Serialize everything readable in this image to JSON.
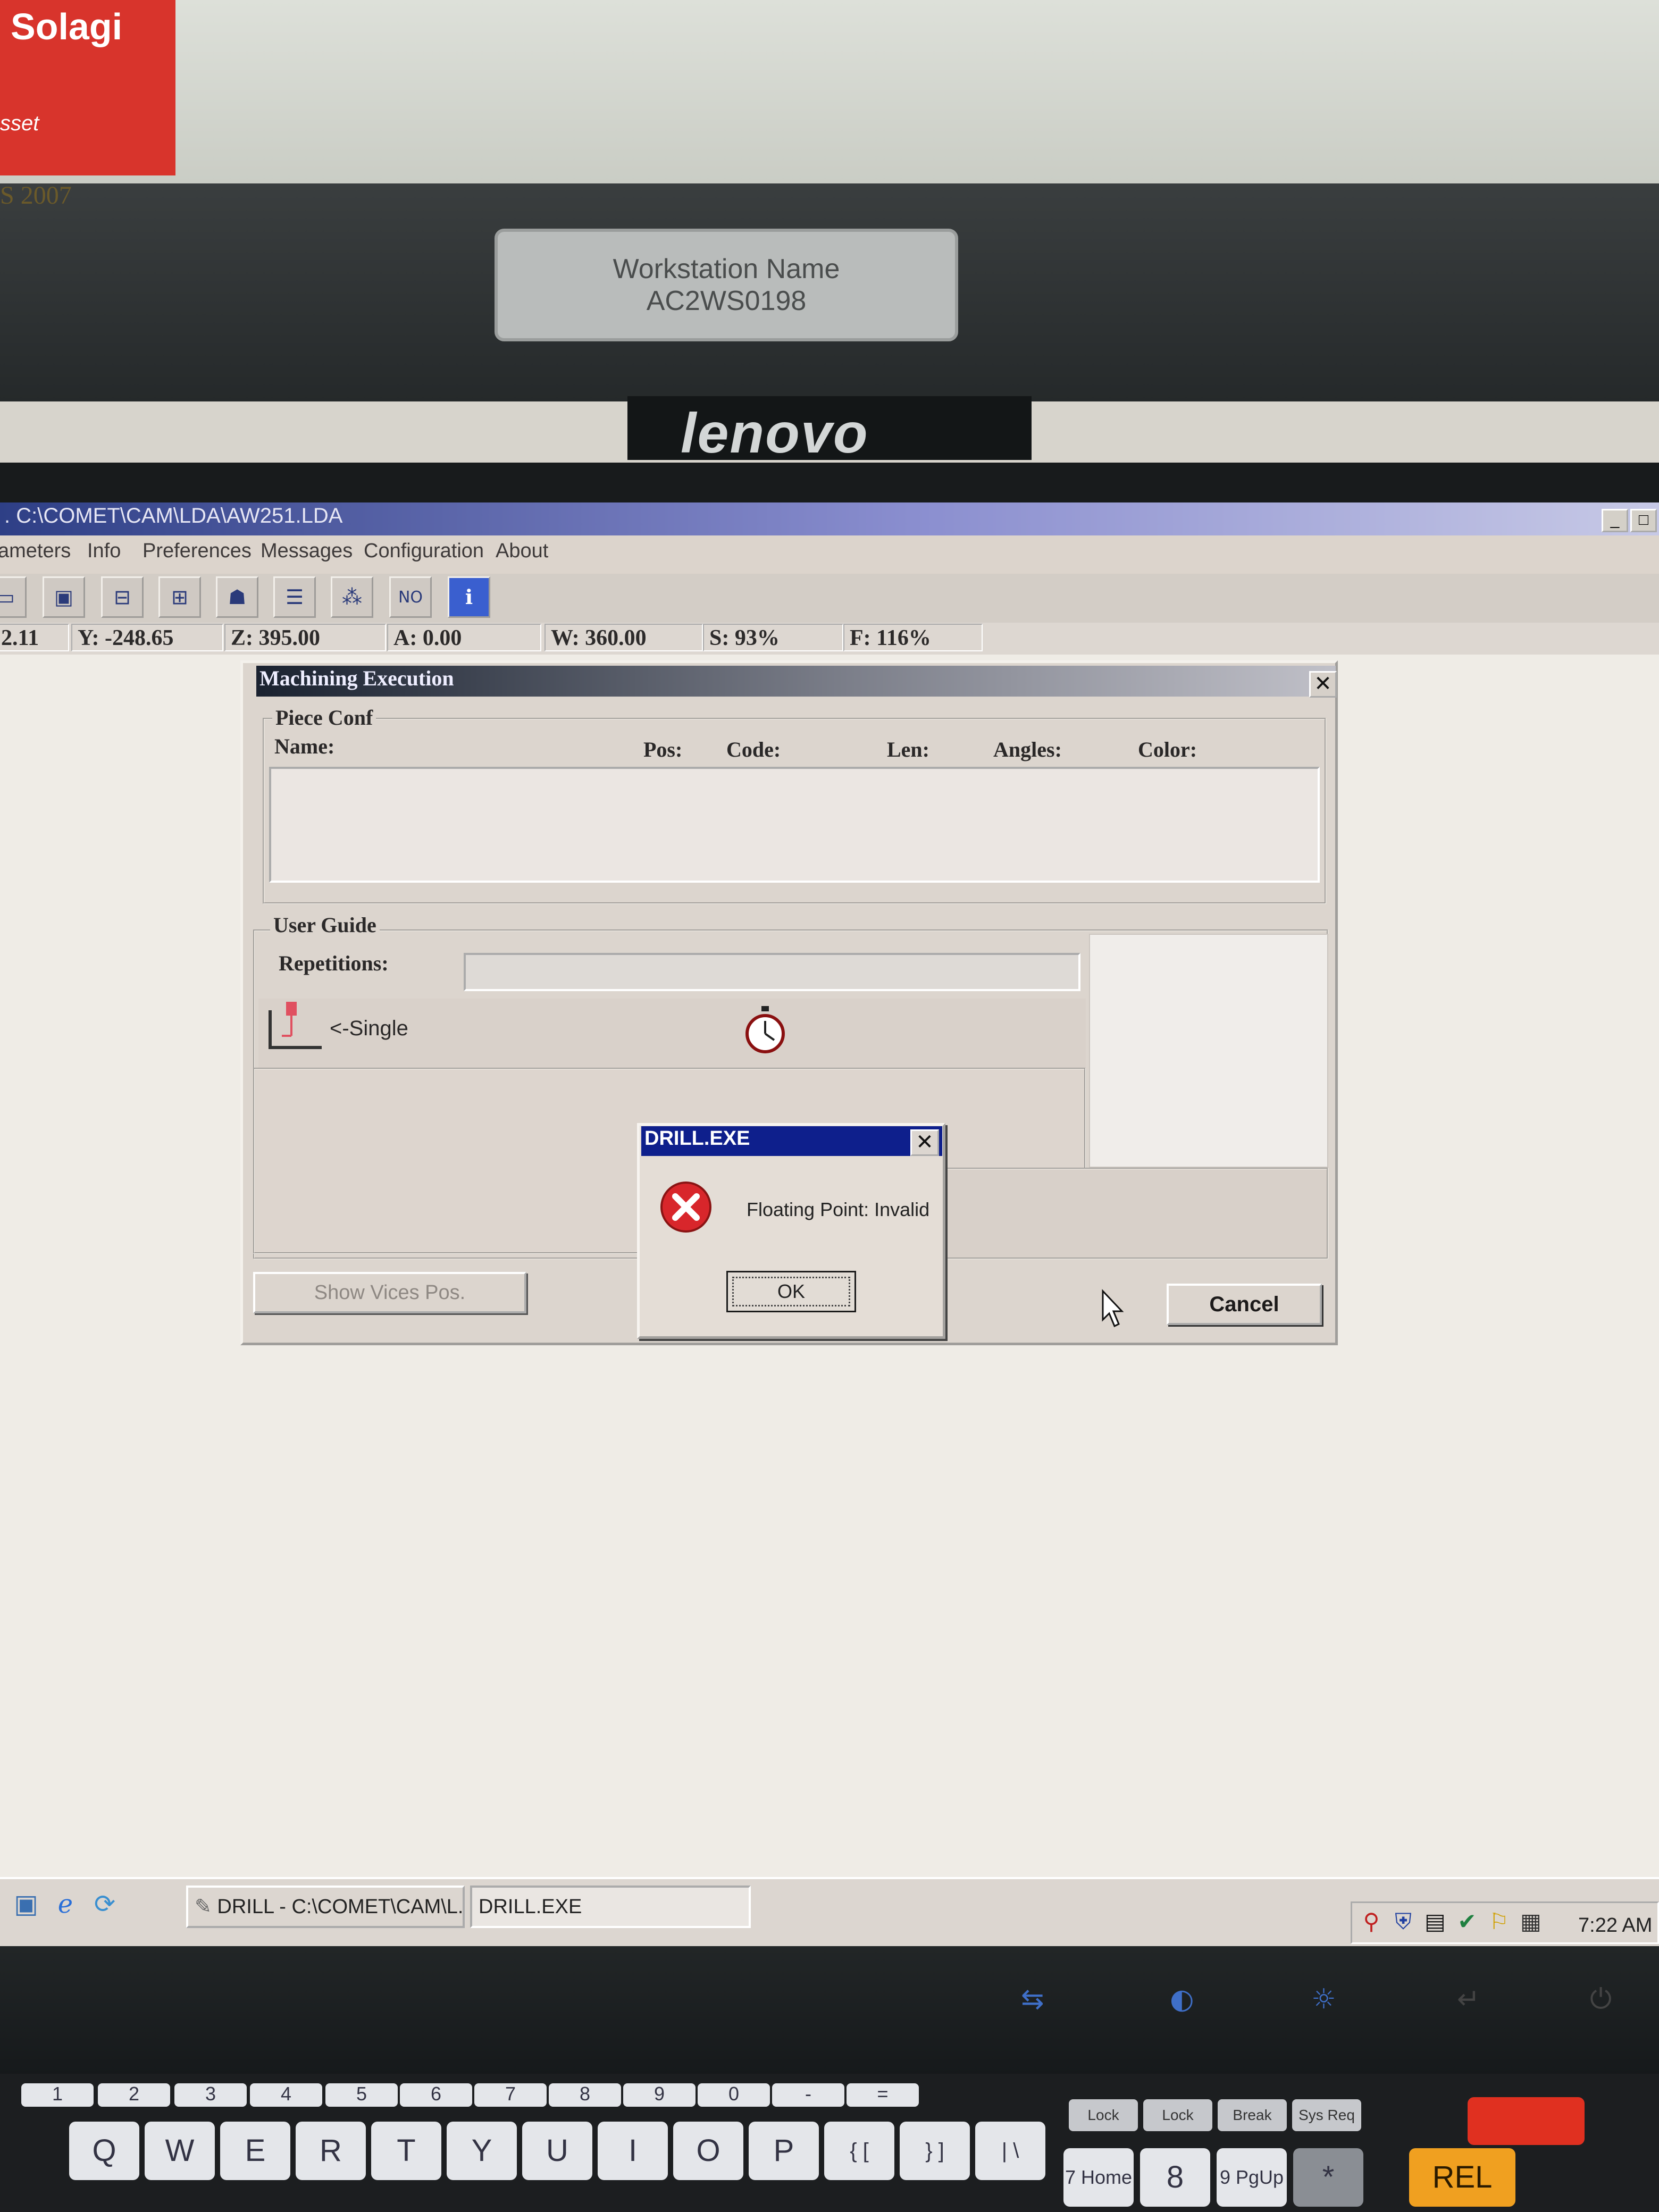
{
  "environment": {
    "sticker_text": "Solagi",
    "sticker_sub": "sset",
    "edge_text": "S 2007",
    "workstation_label": [
      "Workstation Name",
      "AC2WS0198"
    ],
    "brand": "lenovo"
  },
  "window": {
    "title": ". C:\\COMET\\CAM\\LDA\\AW251.LDA",
    "menus": [
      "ameters",
      "Info",
      "Preferences",
      "Messages",
      "Configuration",
      "About"
    ]
  },
  "toolbar": {
    "tools": [
      "tool-1",
      "tool-2",
      "tool-3",
      "tool-4",
      "tool-5",
      "tool-6",
      "tool-7",
      "NO",
      "tool-9"
    ],
    "status": {
      "x": "2.11",
      "y": "Y: -248.65",
      "z": "Z: 395.00",
      "a": "A: 0.00",
      "w": "W: 360.00",
      "s": "S: 93%",
      "f": "F: 116%"
    }
  },
  "machining_dialog": {
    "title": "Machining Execution",
    "piece_conf": {
      "label": "Piece Conf",
      "columns": [
        "Name:",
        "Pos:",
        "Code:",
        "Len:",
        "Angles:",
        "Color:"
      ],
      "rows": []
    },
    "user_guide": {
      "label": "User Guide",
      "repetitions_label": "Repetitions:",
      "repetitions_value": "",
      "single_label": "<-Single"
    },
    "show_vices_button": "Show Vices Pos.",
    "cancel_button": "Cancel"
  },
  "message_box": {
    "title": "DRILL.EXE",
    "message": "Floating Point: Invalid",
    "ok_button": "OK",
    "icon": "error-icon"
  },
  "taskbar": {
    "tasks": [
      {
        "label": "DRILL - C:\\COMET\\CAM\\L...",
        "active": false
      },
      {
        "label": "DRILL.EXE",
        "active": true
      }
    ],
    "clock": "7:22 AM"
  },
  "keyboard": {
    "number_row": [
      "1",
      "2",
      "3",
      "4",
      "5",
      "6",
      "7",
      "8",
      "9",
      "0",
      "-",
      "="
    ],
    "letter_row": [
      "Q",
      "W",
      "E",
      "R",
      "T",
      "Y",
      "U",
      "I",
      "O",
      "P",
      "{ [",
      "} ]",
      "| \\"
    ],
    "lock_keys": [
      "Lock",
      "Lock",
      "Break",
      "Sys Req"
    ],
    "numpad": [
      "7 Home",
      "8",
      "9 PgUp",
      "*"
    ],
    "rel_key": "REL"
  },
  "colors": {
    "titlebar": "#2e3f86",
    "message_titlebar": "#0e1f8c",
    "error_red": "#d8262b",
    "dialog_face": "#dcd5ce"
  }
}
